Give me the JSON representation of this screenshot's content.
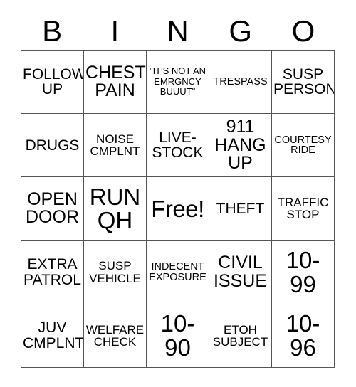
{
  "header": {
    "letters": [
      "B",
      "I",
      "N",
      "G",
      "O"
    ]
  },
  "grid": {
    "rows": 5,
    "columns": 5,
    "border_color": "#555555",
    "background_color": "#ffffff",
    "text_color": "#000000",
    "cells": [
      {
        "text": "FOLLOW UP",
        "size": "md",
        "row": 1,
        "col": 1
      },
      {
        "text": "CHEST PAIN",
        "size": "lg",
        "row": 1,
        "col": 2
      },
      {
        "text": "\"IT'S NOT AN EMRGNCY BUUUT\"",
        "size": "xxs",
        "row": 1,
        "col": 3
      },
      {
        "text": "TRESPASS",
        "size": "xs",
        "row": 1,
        "col": 4
      },
      {
        "text": "SUSP PERSON",
        "size": "md",
        "row": 1,
        "col": 5
      },
      {
        "text": "DRUGS",
        "size": "md",
        "row": 2,
        "col": 1
      },
      {
        "text": "NOISE CMPLNT",
        "size": "sm",
        "row": 2,
        "col": 2
      },
      {
        "text": "LIVE- STOCK",
        "size": "md",
        "row": 2,
        "col": 3
      },
      {
        "text": "911 HANG UP",
        "size": "lg",
        "row": 2,
        "col": 4
      },
      {
        "text": "COURTESY RIDE",
        "size": "xs",
        "row": 2,
        "col": 5
      },
      {
        "text": "OPEN DOOR",
        "size": "lg",
        "row": 3,
        "col": 1
      },
      {
        "text": "RUN QH",
        "size": "xxl",
        "row": 3,
        "col": 2
      },
      {
        "text": "Free!",
        "size": "xxl",
        "row": 3,
        "col": 3
      },
      {
        "text": "THEFT",
        "size": "md",
        "row": 3,
        "col": 4
      },
      {
        "text": "TRAFFIC STOP",
        "size": "sm",
        "row": 3,
        "col": 5
      },
      {
        "text": "EXTRA PATROL",
        "size": "md",
        "row": 4,
        "col": 1
      },
      {
        "text": "SUSP VEHICLE",
        "size": "sm",
        "row": 4,
        "col": 2
      },
      {
        "text": "INDECENT EXPOSURE",
        "size": "xs",
        "row": 4,
        "col": 3
      },
      {
        "text": "CIVIL ISSUE",
        "size": "lg",
        "row": 4,
        "col": 4
      },
      {
        "text": "10- 99",
        "size": "xxl",
        "row": 4,
        "col": 5
      },
      {
        "text": "JUV CMPLNT",
        "size": "md",
        "row": 5,
        "col": 1
      },
      {
        "text": "WELFARE CHECK",
        "size": "sm",
        "row": 5,
        "col": 2
      },
      {
        "text": "10- 90",
        "size": "xxl",
        "row": 5,
        "col": 3
      },
      {
        "text": "ETOH SUBJECT",
        "size": "sm",
        "row": 5,
        "col": 4
      },
      {
        "text": "10- 96",
        "size": "xxl",
        "row": 5,
        "col": 5
      }
    ]
  }
}
